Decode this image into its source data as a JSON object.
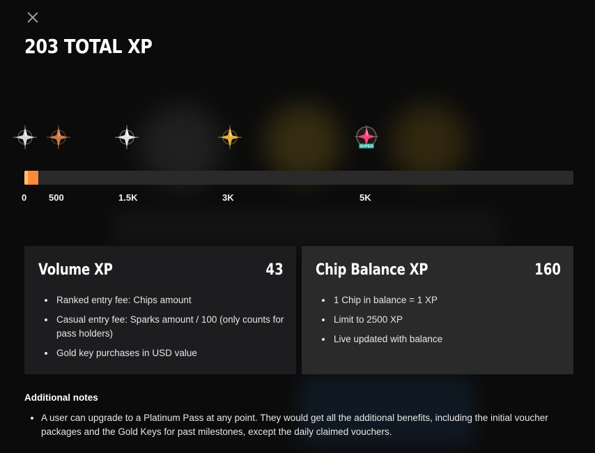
{
  "header": {
    "close_icon": "close-icon",
    "title": "203 TOTAL XP"
  },
  "progress": {
    "current_xp": 203,
    "max_xp": 5000,
    "fill_fraction": 0.025,
    "fill_color": "#ff8a3d",
    "ticks": [
      {
        "label": "0"
      },
      {
        "label": "500"
      },
      {
        "label": "1.5K"
      },
      {
        "label": "3K"
      },
      {
        "label": "5K"
      }
    ],
    "milestones": [
      {
        "icon": "silver-star-badge-icon",
        "color": "#c9c9c9"
      },
      {
        "icon": "bronze-star-badge-icon",
        "color": "#c77a4a"
      },
      {
        "icon": "silver-star-badge-icon",
        "color": "#d9d9d9"
      },
      {
        "icon": "gold-star-badge-icon",
        "color": "#e6b23c"
      },
      {
        "icon": "super-star-badge-icon",
        "color": "#ff3f7a",
        "label": "SUPER"
      }
    ]
  },
  "cards": [
    {
      "title": "Volume XP",
      "value": "43",
      "items": [
        "Ranked entry fee: Chips amount",
        "Casual entry fee: Sparks amount / 100 (only counts for pass holders)",
        "Gold key purchases in USD value"
      ]
    },
    {
      "title": "Chip Balance XP",
      "value": "160",
      "items": [
        "1 Chip in balance = 1 XP",
        "Limit to 2500 XP",
        "Live updated with balance"
      ]
    }
  ],
  "notes": {
    "title": "Additional notes",
    "items": [
      "A user can upgrade to a Platinum Pass at any point. They would get all the additional benefits, including the initial voucher packages and the Gold Keys for past milestones, except the daily claimed vouchers."
    ]
  }
}
